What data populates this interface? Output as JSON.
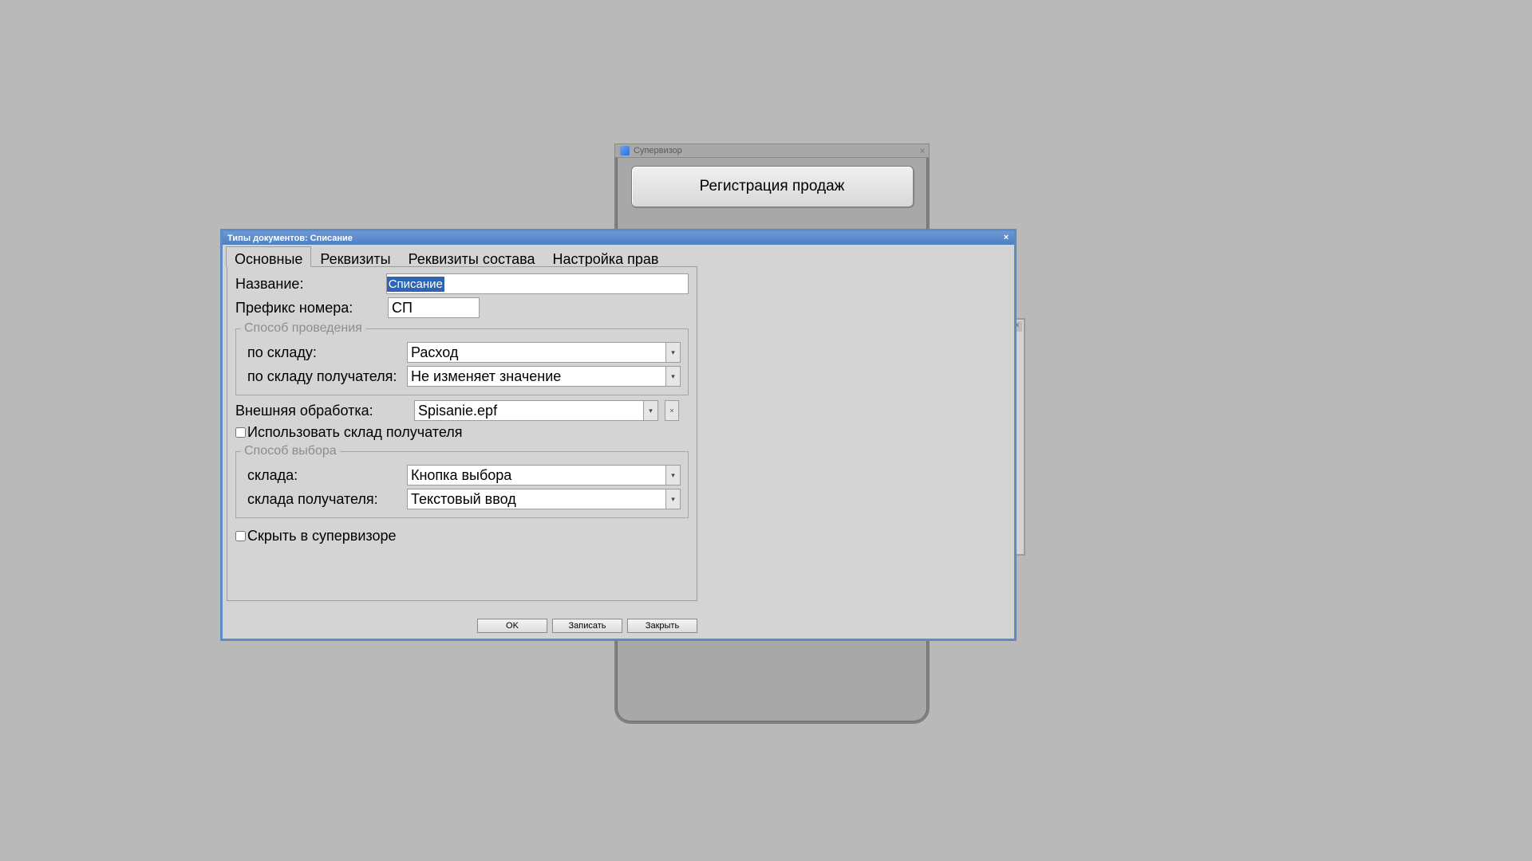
{
  "supervisor": {
    "title": "Супервизор",
    "big_button": "Регистрация продаж"
  },
  "dialog": {
    "title": "Типы документов: Списание",
    "tabs": [
      "Основные",
      "Реквизиты",
      "Реквизиты состава",
      "Настройка прав"
    ],
    "labels": {
      "name": "Название:",
      "prefix": "Префикс номера:",
      "mode_group": "Способ проведения",
      "by_warehouse": "по складу:",
      "by_warehouse_recipient": "по складу получателя:",
      "external_processing": "Внешняя обработка:",
      "use_recipient_store": "Использовать склад получателя",
      "select_group": "Способ выбора",
      "store": "склада:",
      "store_recipient": "склада получателя:",
      "hide_in_supervisor": "Скрыть в супервизоре"
    },
    "values": {
      "name": "Списание",
      "prefix": "СП",
      "by_warehouse": "Расход",
      "by_warehouse_recipient": "Не изменяет значение",
      "external_processing": "Spisanie.epf",
      "store": "Кнопка выбора",
      "store_recipient": "Текстовый ввод"
    },
    "buttons": {
      "ok": "OK",
      "write": "Записать",
      "close": "Закрыть"
    }
  }
}
